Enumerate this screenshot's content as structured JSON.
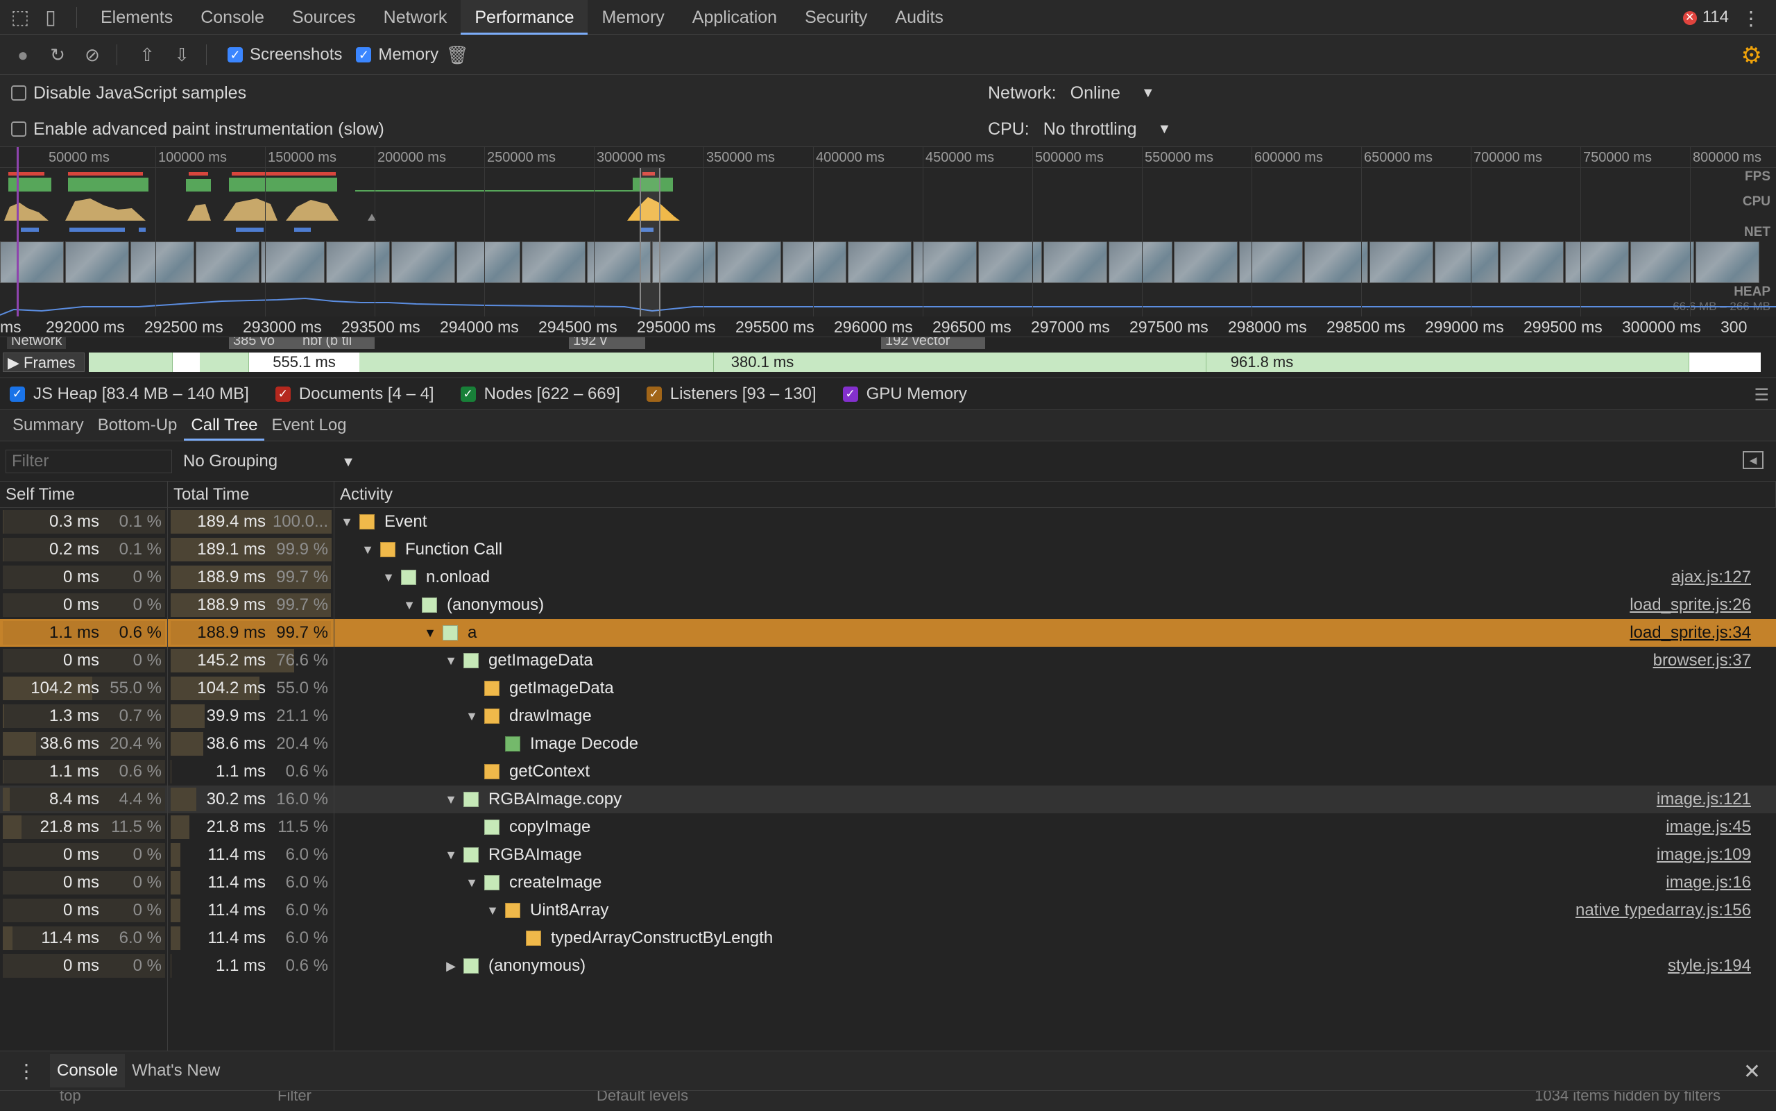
{
  "tabs": [
    "Elements",
    "Console",
    "Sources",
    "Network",
    "Performance",
    "Memory",
    "Application",
    "Security",
    "Audits"
  ],
  "active_tab": "Performance",
  "error_count": "114",
  "toolbar": {
    "screenshots_label": "Screenshots",
    "screenshots_checked": true,
    "memory_label": "Memory",
    "memory_checked": true
  },
  "settings": {
    "disable_js_samples": "Disable JavaScript samples",
    "enable_paint": "Enable advanced paint instrumentation (slow)",
    "network_label": "Network:",
    "network_value": "Online",
    "cpu_label": "CPU:",
    "cpu_value": "No throttling"
  },
  "overview": {
    "ticks": [
      "50000 ms",
      "100000 ms",
      "150000 ms",
      "200000 ms",
      "250000 ms",
      "300000 ms",
      "350000 ms",
      "400000 ms",
      "450000 ms",
      "500000 ms",
      "550000 ms",
      "600000 ms",
      "650000 ms",
      "700000 ms",
      "750000 ms",
      "800000 ms"
    ],
    "lanes": {
      "fps": "FPS",
      "cpu": "CPU",
      "net": "NET",
      "heap": "HEAP"
    },
    "heap_range": "66.6 MB – 266 MB"
  },
  "detail_ticks": [
    "ms",
    "292000 ms",
    "292500 ms",
    "293000 ms",
    "293500 ms",
    "294000 ms",
    "294500 ms",
    "295000 ms",
    "295500 ms",
    "296000 ms",
    "296500 ms",
    "297000 ms",
    "297500 ms",
    "298000 ms",
    "298500 ms",
    "299000 ms",
    "299500 ms",
    "300000 ms",
    "300"
  ],
  "network_row": {
    "label": "Network",
    "items": [
      "385 vo",
      "nbf (b til",
      "192 v",
      "192 vector"
    ]
  },
  "frames": {
    "label": "Frames",
    "segments": [
      "555.1 ms",
      "380.1 ms",
      "961.8 ms"
    ]
  },
  "memory_legend": [
    {
      "label": "JS Heap [83.4 MB – 140 MB]",
      "color": "#1a73e8"
    },
    {
      "label": "Documents [4 – 4]",
      "color": "#b5281e"
    },
    {
      "label": "Nodes [622 – 669]",
      "color": "#188038"
    },
    {
      "label": "Listeners [93 – 130]",
      "color": "#a16518"
    },
    {
      "label": "GPU Memory",
      "color": "#8430ce"
    }
  ],
  "subtabs": [
    "Summary",
    "Bottom-Up",
    "Call Tree",
    "Event Log"
  ],
  "active_subtab": "Call Tree",
  "filter": {
    "placeholder": "Filter",
    "grouping": "No Grouping"
  },
  "columns": {
    "self": "Self Time",
    "total": "Total Time",
    "activity": "Activity"
  },
  "rows": [
    {
      "self_ms": "0.3 ms",
      "self_pct": "0.1 %",
      "self_frac": 0.001,
      "total_ms": "189.4 ms",
      "total_pct": "100.0...",
      "total_frac": 1.0,
      "depth": 0,
      "tri": "▼",
      "color": "#f0b94a",
      "name": "Event",
      "link": ""
    },
    {
      "self_ms": "0.2 ms",
      "self_pct": "0.1 %",
      "self_frac": 0.001,
      "total_ms": "189.1 ms",
      "total_pct": "99.9 %",
      "total_frac": 0.999,
      "depth": 1,
      "tri": "▼",
      "color": "#f0b94a",
      "name": "Function Call",
      "link": ""
    },
    {
      "self_ms": "0 ms",
      "self_pct": "0 %",
      "self_frac": 0,
      "total_ms": "188.9 ms",
      "total_pct": "99.7 %",
      "total_frac": 0.997,
      "depth": 2,
      "tri": "▼",
      "color": "#c6e9b8",
      "name": "n.onload",
      "link": "ajax.js:127"
    },
    {
      "self_ms": "0 ms",
      "self_pct": "0 %",
      "self_frac": 0,
      "total_ms": "188.9 ms",
      "total_pct": "99.7 %",
      "total_frac": 0.997,
      "depth": 3,
      "tri": "▼",
      "color": "#c6e9b8",
      "name": "(anonymous)",
      "link": "load_sprite.js:26"
    },
    {
      "self_ms": "1.1 ms",
      "self_pct": "0.6 %",
      "self_frac": 0.006,
      "total_ms": "188.9 ms",
      "total_pct": "99.7 %",
      "total_frac": 0.997,
      "depth": 4,
      "tri": "▼",
      "color": "#c6e9b8",
      "name": "a",
      "link": "load_sprite.js:34",
      "selected": true
    },
    {
      "self_ms": "0 ms",
      "self_pct": "0 %",
      "self_frac": 0,
      "total_ms": "145.2 ms",
      "total_pct": "76.6 %",
      "total_frac": 0.766,
      "depth": 5,
      "tri": "▼",
      "color": "#c6e9b8",
      "name": "getImageData",
      "link": "browser.js:37"
    },
    {
      "self_ms": "104.2 ms",
      "self_pct": "55.0 %",
      "self_frac": 0.55,
      "total_ms": "104.2 ms",
      "total_pct": "55.0 %",
      "total_frac": 0.55,
      "depth": 6,
      "tri": "",
      "color": "#f0b94a",
      "name": "getImageData",
      "link": ""
    },
    {
      "self_ms": "1.3 ms",
      "self_pct": "0.7 %",
      "self_frac": 0.007,
      "total_ms": "39.9 ms",
      "total_pct": "21.1 %",
      "total_frac": 0.211,
      "depth": 6,
      "tri": "▼",
      "color": "#f0b94a",
      "name": "drawImage",
      "link": ""
    },
    {
      "self_ms": "38.6 ms",
      "self_pct": "20.4 %",
      "self_frac": 0.204,
      "total_ms": "38.6 ms",
      "total_pct": "20.4 %",
      "total_frac": 0.204,
      "depth": 7,
      "tri": "",
      "color": "#74b96b",
      "name": "Image Decode",
      "link": ""
    },
    {
      "self_ms": "1.1 ms",
      "self_pct": "0.6 %",
      "self_frac": 0.006,
      "total_ms": "1.1 ms",
      "total_pct": "0.6 %",
      "total_frac": 0.006,
      "depth": 6,
      "tri": "",
      "color": "#f0b94a",
      "name": "getContext",
      "link": ""
    },
    {
      "self_ms": "8.4 ms",
      "self_pct": "4.4 %",
      "self_frac": 0.044,
      "total_ms": "30.2 ms",
      "total_pct": "16.0 %",
      "total_frac": 0.16,
      "depth": 5,
      "tri": "▼",
      "color": "#c6e9b8",
      "name": "RGBAImage.copy",
      "link": "image.js:121",
      "hover": true
    },
    {
      "self_ms": "21.8 ms",
      "self_pct": "11.5 %",
      "self_frac": 0.115,
      "total_ms": "21.8 ms",
      "total_pct": "11.5 %",
      "total_frac": 0.115,
      "depth": 6,
      "tri": "",
      "color": "#c6e9b8",
      "name": "copyImage",
      "link": "image.js:45"
    },
    {
      "self_ms": "0 ms",
      "self_pct": "0 %",
      "self_frac": 0,
      "total_ms": "11.4 ms",
      "total_pct": "6.0 %",
      "total_frac": 0.06,
      "depth": 5,
      "tri": "▼",
      "color": "#c6e9b8",
      "name": "RGBAImage",
      "link": "image.js:109"
    },
    {
      "self_ms": "0 ms",
      "self_pct": "0 %",
      "self_frac": 0,
      "total_ms": "11.4 ms",
      "total_pct": "6.0 %",
      "total_frac": 0.06,
      "depth": 6,
      "tri": "▼",
      "color": "#c6e9b8",
      "name": "createImage",
      "link": "image.js:16"
    },
    {
      "self_ms": "0 ms",
      "self_pct": "0 %",
      "self_frac": 0,
      "total_ms": "11.4 ms",
      "total_pct": "6.0 %",
      "total_frac": 0.06,
      "depth": 7,
      "tri": "▼",
      "color": "#f0b94a",
      "name": "Uint8Array",
      "link": "native typedarray.js:156"
    },
    {
      "self_ms": "11.4 ms",
      "self_pct": "6.0 %",
      "self_frac": 0.06,
      "total_ms": "11.4 ms",
      "total_pct": "6.0 %",
      "total_frac": 0.06,
      "depth": 8,
      "tri": "",
      "color": "#f0b94a",
      "name": "typedArrayConstructByLength",
      "link": ""
    },
    {
      "self_ms": "0 ms",
      "self_pct": "0 %",
      "self_frac": 0,
      "total_ms": "1.1 ms",
      "total_pct": "0.6 %",
      "total_frac": 0.006,
      "depth": 5,
      "tri": "▶",
      "color": "#c6e9b8",
      "name": "(anonymous)",
      "link": "style.js:194"
    }
  ],
  "drawer": {
    "tabs": [
      "Console",
      "What's New"
    ],
    "active": "Console",
    "strip": [
      "top",
      "Filter",
      "Default levels",
      "1034 items hidden by filters"
    ]
  }
}
